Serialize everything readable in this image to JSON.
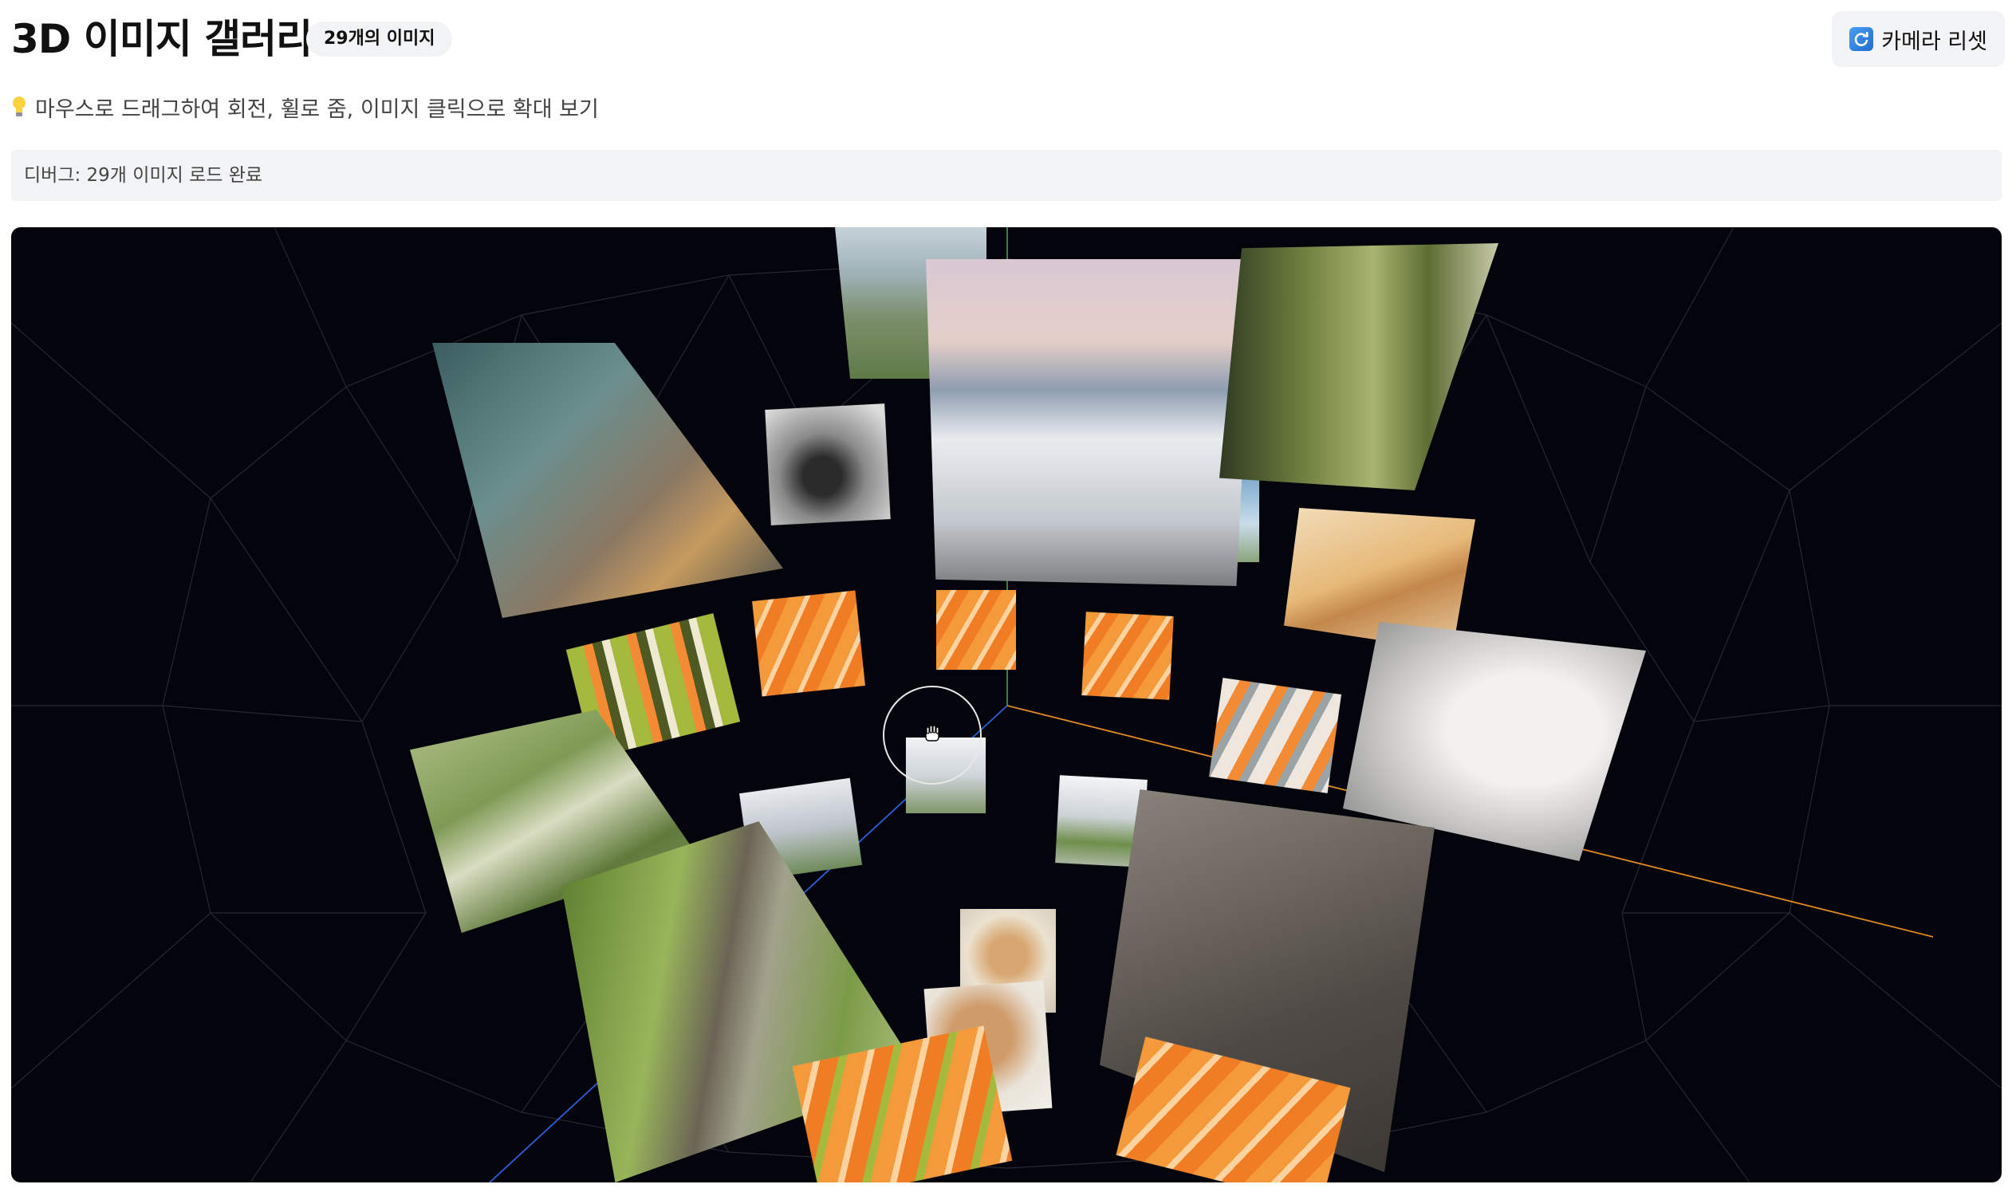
{
  "header": {
    "title": "3D 이미지 갤러리",
    "image_count_badge": "29개의 이미지",
    "reset_button_label": "카메라 리셋"
  },
  "hint": {
    "text": "마우스로 드래그하여 회전, 휠로 줌, 이미지 클릭으로 확대 보기",
    "icon": "lightbulb-icon"
  },
  "debug": {
    "text": "디버그: 29개 이미지 로드 완료"
  },
  "gallery": {
    "image_count": 29,
    "background": "#04040c",
    "cursor": "grab-hand-icon",
    "photos": [
      "lantern",
      "mountain-valley",
      "sea-of-clouds-peaks",
      "pine-forest",
      "motorcycle-bw",
      "desert-dune",
      "salmon-sushi",
      "salmon-sushi",
      "salmon-sushi",
      "sushi-roll",
      "sushi-roll",
      "white-cat",
      "forest-stream",
      "tree-trunk-moss",
      "city-palms",
      "city-park",
      "tabby-cat",
      "tabby-cat",
      "vintage-camera",
      "salmon-sushi",
      "salmon-sushi",
      "seaside-cliff",
      "city-buildings",
      "salmon-sushi"
    ]
  },
  "colors": {
    "accent": "#1f6ccf",
    "badge_bg": "#f2f3f5",
    "axis_x": "#e08a1e",
    "axis_y": "#3bb04a",
    "axis_z": "#2a5fd8"
  }
}
